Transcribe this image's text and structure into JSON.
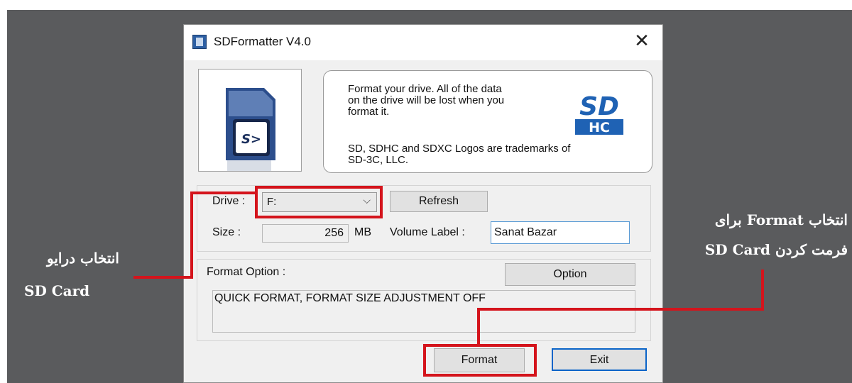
{
  "window": {
    "title": "SDFormatter V4.0",
    "close_glyph": "✕"
  },
  "info": {
    "line1": "Format your drive. All of the data",
    "line2": "on the drive will be lost when you",
    "line3": "format it.",
    "line4": "SD, SDHC and SDXC Logos are trademarks of",
    "line5": "SD-3C, LLC.",
    "logo_top": "SD",
    "logo_bottom": "HC"
  },
  "drive": {
    "label": "Drive :",
    "value": "F:",
    "refresh_label": "Refresh"
  },
  "size": {
    "label": "Size  :",
    "value": "256",
    "unit": "MB"
  },
  "volume": {
    "label": "Volume Label  :",
    "value": "Sanat Bazar"
  },
  "format_option": {
    "label": "Format Option :",
    "option_button": "Option",
    "text": "QUICK FORMAT, FORMAT SIZE ADJUSTMENT OFF"
  },
  "actions": {
    "format_label": "Format",
    "exit_label": "Exit"
  },
  "annotations": {
    "left_line1": "انتخاب درایو",
    "left_line2": "SD Card",
    "right_line1_fa_a": "انتخاب",
    "right_line1_en": "Format",
    "right_line1_fa_b": "برای",
    "right_line2_fa": "فرمت کردن",
    "right_line2_en": "SD Card"
  },
  "colors": {
    "highlight": "#d4141c",
    "background": "#5a5b5d",
    "sd_logo_blue": "#1f62b4"
  }
}
